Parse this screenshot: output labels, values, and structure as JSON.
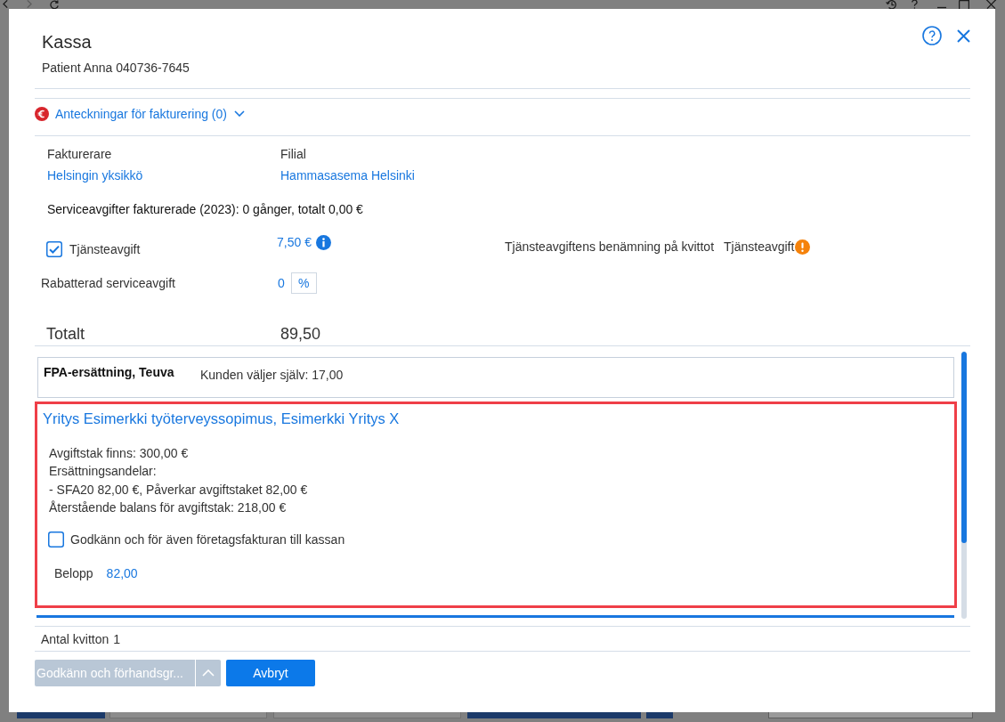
{
  "dialog": {
    "title": "Kassa",
    "subtitle": "Patient Anna 040736-7645"
  },
  "billing_notes": {
    "label": "Anteckningar för fakturering (0)",
    "expanded": false
  },
  "biller": {
    "label": "Fakturerare",
    "value": "Helsingin yksikkö"
  },
  "branch": {
    "label": "Filial",
    "value": "Hammasasema Helsinki"
  },
  "fees_summary": "Serviceavgifter fakturerade (2023): 0 gånger, totalt 0,00 €",
  "service_fee": {
    "label": "Tjänsteavgift",
    "checked": true,
    "amount": "7,50 €",
    "receipt_label": "Tjänsteavgiftens benämning på kvittot",
    "receipt_value": "Tjänsteavgift"
  },
  "discount": {
    "label": "Rabatterad serviceavgift",
    "value": "0",
    "unit": "%"
  },
  "total": {
    "label": "Totalt",
    "value": "89,50"
  },
  "payers": [
    {
      "kind": "simple",
      "highlighted": false,
      "name": "FPA-ersättning, Teuva",
      "detail": "Kunden väljer själv: 17,00"
    },
    {
      "kind": "contract",
      "highlighted": true,
      "name": "Yritys Esimerkki työterveyssopimus, Esimerkki Yritys X",
      "lines": [
        "Avgiftstak finns: 300,00 €",
        "Ersättningsandelar:",
        "- SFA20 82,00 €, Påverkar avgiftstaket 82,00 €",
        "Återstående balans för avgiftstak: 218,00 €"
      ],
      "approve": {
        "label": "Godkänn och för även företagsfakturan till kassan",
        "checked": false
      },
      "amount_label": "Belopp",
      "amount": "82,00"
    }
  ],
  "receipts": {
    "label": "Antal kvitton",
    "value": "1"
  },
  "buttons": [
    {
      "kind": "split",
      "label": "Godkänn och förhandsgr...",
      "disabled": true
    },
    {
      "kind": "primary",
      "label": "Avbryt",
      "disabled": false
    }
  ]
}
